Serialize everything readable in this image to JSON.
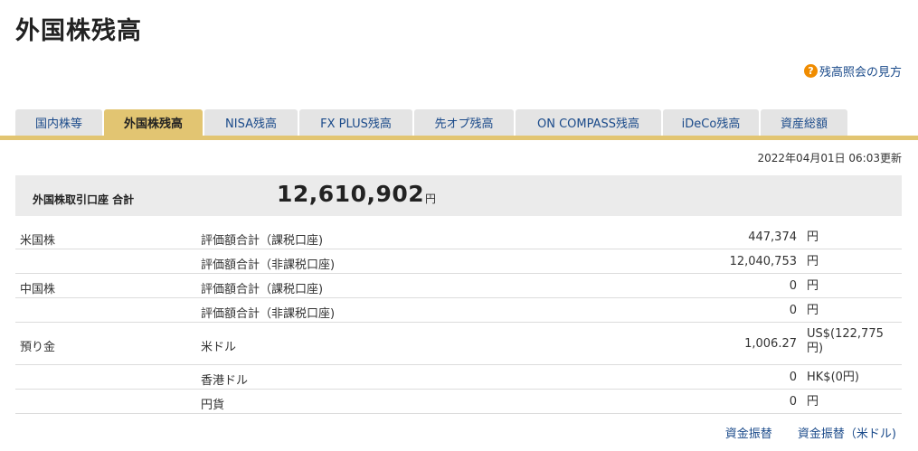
{
  "page_title": "外国株残高",
  "help": {
    "icon": "question-icon",
    "icon_glyph": "?",
    "label": "残高照会の見方"
  },
  "tabs": [
    {
      "label": "国内株等"
    },
    {
      "label": "外国株残高"
    },
    {
      "label": "NISA残高"
    },
    {
      "label": "FX PLUS残高"
    },
    {
      "label": "先オプ残高"
    },
    {
      "label": "ON COMPASS残高"
    },
    {
      "label": "iDeCo残高"
    },
    {
      "label": "資産総額"
    }
  ],
  "active_tab": "外国株残高",
  "updated": "2022年04月01日 06:03更新",
  "summary": {
    "label": "外国株取引口座 合計",
    "value": "12,610,902",
    "unit": "円"
  },
  "rows": [
    {
      "category": "米国株",
      "item": "評価額合計（課税口座)",
      "value": "447,374",
      "unit": "円"
    },
    {
      "category": "",
      "item": "評価額合計（非課税口座)",
      "value": "12,040,753",
      "unit": "円"
    },
    {
      "category": "中国株",
      "item": "評価額合計（課税口座)",
      "value": "0",
      "unit": "円"
    },
    {
      "category": "",
      "item": "評価額合計（非課税口座)",
      "value": "0",
      "unit": "円"
    },
    {
      "category": "預り金",
      "item": "米ドル",
      "value": "1,006.27",
      "unit": "US$(122,775円)"
    },
    {
      "category": "",
      "item": "香港ドル",
      "value": "0",
      "unit": "HK$(0円)"
    },
    {
      "category": "",
      "item": "円貨",
      "value": "0",
      "unit": "円"
    }
  ],
  "footer_links": {
    "transfer": "資金振替",
    "transfer_usd": "資金振替（米ドル)"
  },
  "colors": {
    "tab_active": "#e2c572",
    "tab_inactive": "#e4e4e4",
    "link": "#1a4a8a",
    "help_icon": "#f08c00"
  }
}
